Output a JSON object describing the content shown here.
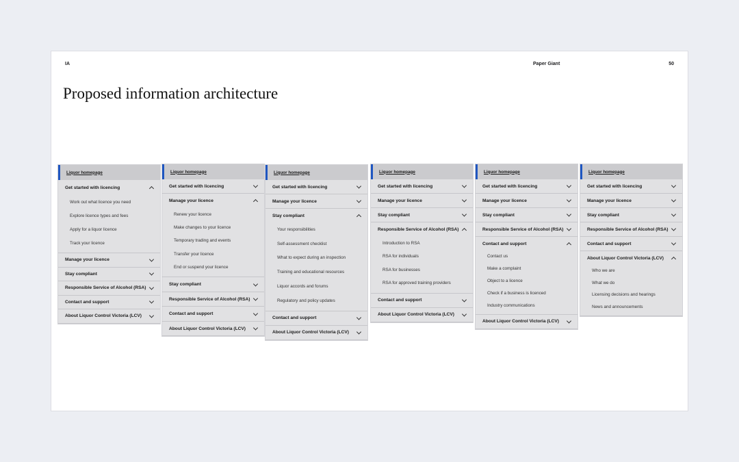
{
  "header": {
    "left": "IA",
    "center": "Paper Giant",
    "page_number": "50"
  },
  "title": "Proposed information architecture",
  "panels": [
    {
      "home": "Liquor homepage",
      "sections": [
        {
          "label": "Get started with licencing",
          "open": true,
          "items": [
            "Work out what licence you need",
            "Explore licence types and fees",
            "Apply for a liquor licence",
            "Track your licence"
          ]
        },
        {
          "label": "Manage your licence"
        },
        {
          "label": "Stay compliant"
        },
        {
          "label": "Responsible Service of Alcohol (RSA)"
        },
        {
          "label": "Contact and support"
        },
        {
          "label": "About Liquor Control Victoria (LCV)"
        }
      ]
    },
    {
      "home": "Liquor homepage",
      "sections": [
        {
          "label": "Get started with licencing"
        },
        {
          "label": "Manage your licence",
          "open": true,
          "items": [
            "Renew your licence",
            "Make changes to your licence",
            "Temporary trading and events",
            "Transfer your licence",
            "End or suspend your licence"
          ]
        },
        {
          "label": "Stay compliant"
        },
        {
          "label": "Responsible Service of Alcohol (RSA)"
        },
        {
          "label": "Contact and support"
        },
        {
          "label": "About Liquor Control Victoria (LCV)"
        }
      ]
    },
    {
      "home": "Liquor homepage",
      "sections": [
        {
          "label": "Get started with licencing"
        },
        {
          "label": "Manage your licence"
        },
        {
          "label": "Stay compliant",
          "open": true,
          "items": [
            "Your responsibilities",
            "Self-assessment checklist",
            "What to expect during an inspection",
            "Training and educational resources",
            "Liquor accords and forums",
            "Regulatory and policy updates"
          ]
        },
        {
          "label": "Contact and support"
        },
        {
          "label": "About Liquor Control Victoria (LCV)"
        }
      ]
    },
    {
      "home": "Liquor homepage",
      "sections": [
        {
          "label": "Get started with licencing"
        },
        {
          "label": "Manage your licence"
        },
        {
          "label": "Stay compliant"
        },
        {
          "label": "Responsible Service of Alcohol (RSA)",
          "open": true,
          "items": [
            "Introduction to RSA",
            "RSA for individuals",
            "RSA for businesses",
            "RSA for approved training providers"
          ]
        },
        {
          "label": "Contact and support"
        },
        {
          "label": "About Liquor Control Victoria (LCV)"
        }
      ]
    },
    {
      "home": "Liquor homepage",
      "sections": [
        {
          "label": "Get started with licencing"
        },
        {
          "label": "Manage your licence"
        },
        {
          "label": "Stay compliant"
        },
        {
          "label": "Responsible Service of Alcohol (RSA)"
        },
        {
          "label": "Contact and support",
          "open": true,
          "items": [
            "Contact us",
            "Make a complaint",
            "Object to a licence",
            "Check if a business is licenced",
            "Industry communications"
          ]
        },
        {
          "label": "About Liquor Control Victoria (LCV)"
        }
      ]
    },
    {
      "home": "Liquor homepage",
      "sections": [
        {
          "label": "Get started with licencing"
        },
        {
          "label": "Manage your licence"
        },
        {
          "label": "Stay compliant"
        },
        {
          "label": "Responsible Service of Alcohol (RSA)"
        },
        {
          "label": "Contact and support"
        },
        {
          "label": "About Liquor Control Victoria (LCV)",
          "open": true,
          "items": [
            "Who we are",
            "What we do",
            "Licensing decisions and hearings",
            "News and announcements"
          ]
        }
      ]
    }
  ]
}
